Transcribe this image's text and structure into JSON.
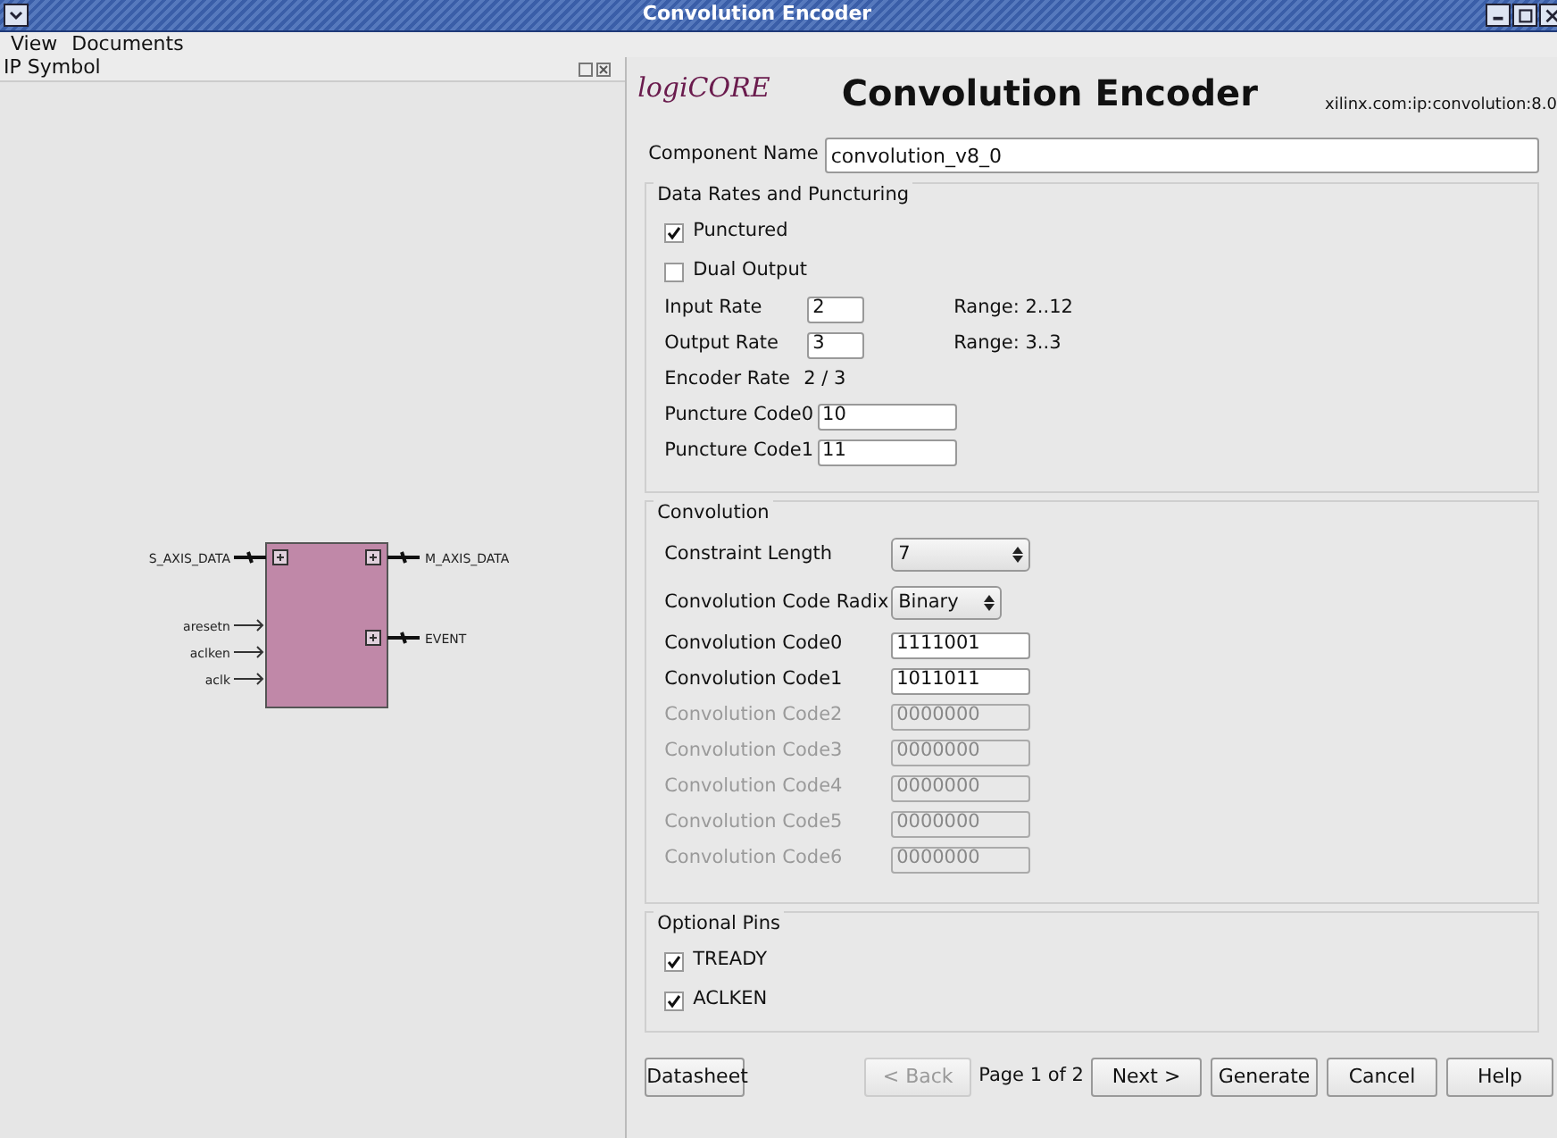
{
  "window": {
    "title": "Convolution Encoder"
  },
  "menu": [
    {
      "label": "View"
    },
    {
      "label": "Documents"
    }
  ],
  "left_panel": {
    "title": "IP Symbol",
    "symbol": {
      "inputs": [
        {
          "label": "S_AXIS_DATA",
          "kind": "bus"
        },
        {
          "label": "aresetn",
          "kind": "wire"
        },
        {
          "label": "aclken",
          "kind": "wire"
        },
        {
          "label": "aclk",
          "kind": "wire"
        }
      ],
      "outputs": [
        {
          "label": "M_AXIS_DATA",
          "kind": "bus"
        },
        {
          "label": "EVENT",
          "kind": "bus"
        }
      ]
    }
  },
  "header": {
    "logo": "logiCORE",
    "title": "Convolution Encoder",
    "vlnv": "xilinx.com:ip:convolution:8.0"
  },
  "component_name": {
    "label": "Component Name",
    "value": "convolution_v8_0"
  },
  "groups": [
    {
      "title": "Data Rates and Puncturing",
      "rows": [
        {
          "kind": "checkbox",
          "label": "Punctured",
          "checked": true
        },
        {
          "kind": "checkbox",
          "label": "Dual Output",
          "checked": false
        },
        {
          "kind": "field",
          "label": "Input Rate",
          "value": "2",
          "range": "Range: 2..12"
        },
        {
          "kind": "field",
          "label": "Output Rate",
          "value": "3",
          "range": "Range: 3..3"
        },
        {
          "kind": "readout",
          "label": "Encoder Rate",
          "value": "2 / 3"
        },
        {
          "kind": "field",
          "label": "Puncture Code0",
          "value": "10"
        },
        {
          "kind": "field",
          "label": "Puncture Code1",
          "value": "11"
        }
      ]
    },
    {
      "title": "Convolution",
      "rows": [
        {
          "kind": "select",
          "label": "Constraint Length",
          "value": "7"
        },
        {
          "kind": "select",
          "label": "Convolution Code Radix",
          "value": "Binary"
        },
        {
          "kind": "code",
          "label": "Convolution Code0",
          "value": "1111001",
          "disabled": false
        },
        {
          "kind": "code",
          "label": "Convolution Code1",
          "value": "1011011",
          "disabled": false
        },
        {
          "kind": "code",
          "label": "Convolution Code2",
          "value": "0000000",
          "disabled": true
        },
        {
          "kind": "code",
          "label": "Convolution Code3",
          "value": "0000000",
          "disabled": true
        },
        {
          "kind": "code",
          "label": "Convolution Code4",
          "value": "0000000",
          "disabled": true
        },
        {
          "kind": "code",
          "label": "Convolution Code5",
          "value": "0000000",
          "disabled": true
        },
        {
          "kind": "code",
          "label": "Convolution Code6",
          "value": "0000000",
          "disabled": true
        }
      ]
    },
    {
      "title": "Optional Pins",
      "rows": [
        {
          "kind": "checkbox",
          "label": "TREADY",
          "checked": true
        },
        {
          "kind": "checkbox",
          "label": "ACLKEN",
          "checked": true
        }
      ]
    }
  ],
  "footer": {
    "datasheet": {
      "label": "Datasheet"
    },
    "back": {
      "label": "< Back",
      "disabled": true
    },
    "page": "Page 1 of 2",
    "buttons": [
      {
        "label": "Next >"
      },
      {
        "label": "Generate"
      },
      {
        "label": "Cancel"
      },
      {
        "label": "Help"
      }
    ]
  }
}
